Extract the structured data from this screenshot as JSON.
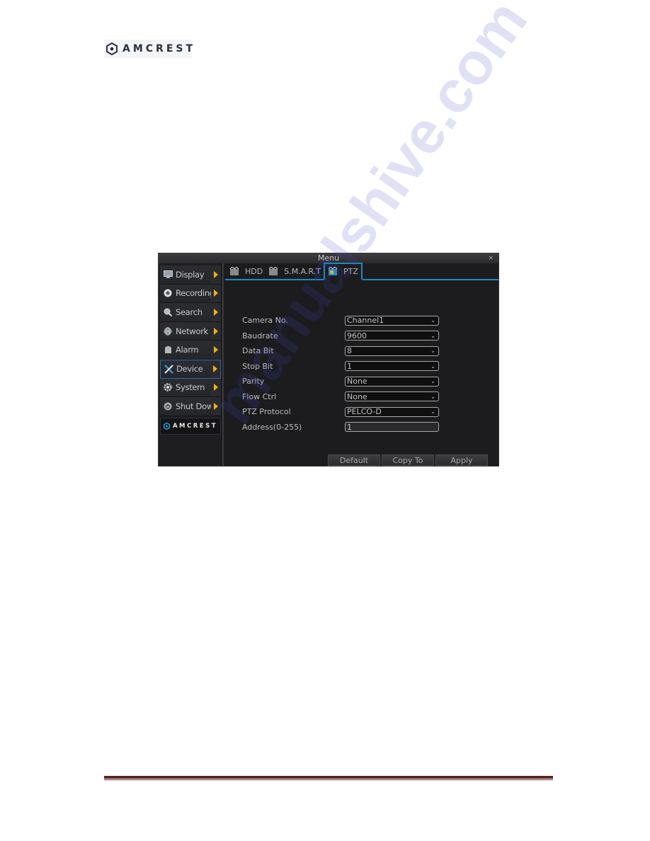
{
  "brand": {
    "name": "AMCREST"
  },
  "window": {
    "title": "Menu",
    "close_icon": "×"
  },
  "sidebar": {
    "items": [
      {
        "label": "Display",
        "icon": "monitor-icon",
        "active": false
      },
      {
        "label": "Recording",
        "icon": "record-icon",
        "active": false
      },
      {
        "label": "Search",
        "icon": "magnifier-icon",
        "active": false
      },
      {
        "label": "Network",
        "icon": "globe-icon",
        "active": false
      },
      {
        "label": "Alarm",
        "icon": "bell-icon",
        "active": false
      },
      {
        "label": "Device",
        "icon": "tools-icon",
        "active": true
      },
      {
        "label": "System",
        "icon": "gear-icon",
        "active": false
      },
      {
        "label": "Shut Down",
        "icon": "power-icon",
        "active": false
      }
    ],
    "logo_text": "AMCREST"
  },
  "tabs": [
    {
      "label": "HDD",
      "active": false
    },
    {
      "label": "S.M.A.R.T",
      "active": false
    },
    {
      "label": "PTZ",
      "active": true
    }
  ],
  "form": {
    "fields": [
      {
        "label": "Camera No.",
        "value": "Channel1",
        "type": "select"
      },
      {
        "label": "Baudrate",
        "value": "9600",
        "type": "select"
      },
      {
        "label": "Data Bit",
        "value": "8",
        "type": "select"
      },
      {
        "label": "Stop Bit",
        "value": "1",
        "type": "select"
      },
      {
        "label": "Parity",
        "value": "None",
        "type": "select"
      },
      {
        "label": "Flow Ctrl",
        "value": "None",
        "type": "select"
      },
      {
        "label": "PTZ Protocol",
        "value": "PELCO-D",
        "type": "select"
      },
      {
        "label": "Address(0-255)",
        "value": "1",
        "type": "text"
      }
    ]
  },
  "buttons": {
    "default": "Default",
    "copy_to": "Copy To",
    "apply": "Apply"
  },
  "watermark": "manualshive.com",
  "colors": {
    "accent_blue": "#1a8cc0",
    "arrow_yellow": "#f2b114",
    "footer_rule": "#5c2424"
  }
}
